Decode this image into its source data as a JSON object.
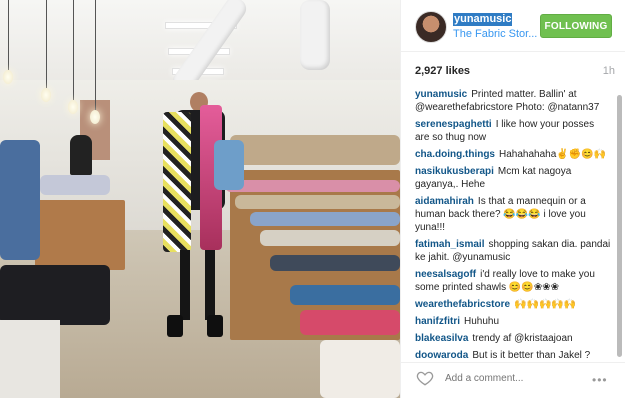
{
  "post": {
    "username": "yunamusic",
    "location": "The Fabric Stor...",
    "follow_label": "FOLLOWING",
    "likes": "2,927 likes",
    "time_ago": "1h"
  },
  "comments": [
    {
      "user": "yunamusic",
      "text": "Printed matter. Ballin' at @wearethefabricstore Photo: @natann37"
    },
    {
      "user": "serenespaghetti",
      "text": "I like how your posses are so thug now"
    },
    {
      "user": "cha.doing.things",
      "text": "Hahahahaha✌️✊️😊🙌"
    },
    {
      "user": "nasikukusberapi",
      "text": "Mcm kat nagoya gayanya,. Hehe"
    },
    {
      "user": "aidamahirah",
      "text": "Is that a mannequin or a human back there? 😂😂😂 i love you yuna!!!"
    },
    {
      "user": "fatimah_ismail",
      "text": "shopping sakan dia. pandai ke jahit. @yunamusic"
    },
    {
      "user": "neesalsagoff",
      "text": "i'd really love to make you some printed shawls 😊😊❀❀❀"
    },
    {
      "user": "wearethefabricstore",
      "text": "🙌🙌🙌🙌🙌"
    },
    {
      "user": "hanifzfitri",
      "text": "Huhuhu"
    },
    {
      "user": "blakeasilva",
      "text": "trendy af @kristaajoan"
    },
    {
      "user": "doowaroda",
      "text": "But is it better than Jakel ?"
    }
  ],
  "footer": {
    "comment_placeholder": "Add a comment...",
    "more_label": "•••"
  },
  "colors": {
    "follow_green": "#70c050",
    "link_blue": "#125688",
    "location_blue": "#3897f0"
  }
}
